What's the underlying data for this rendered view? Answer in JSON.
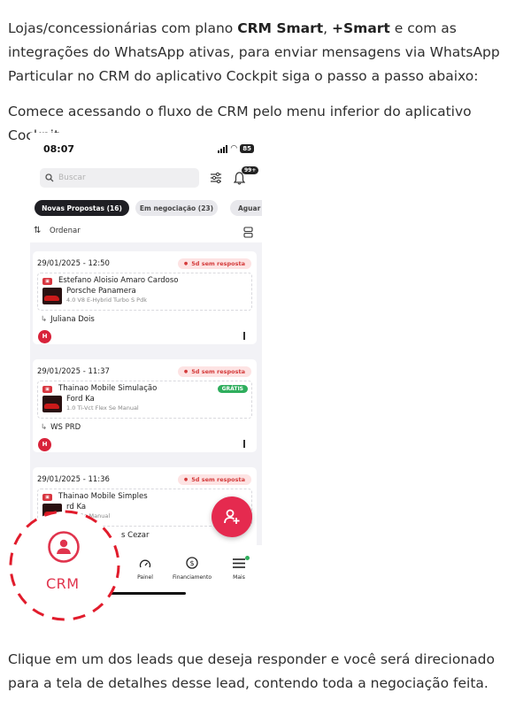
{
  "intro": {
    "p1_start": "Lojas/concessionárias com plano ",
    "p1_bold1": "CRM Smart",
    "p1_mid": ", ",
    "p1_bold2": "+Smart",
    "p1_end": " e com as integrações do WhatsApp ativas, para enviar mensagens via WhatsApp Particular no CRM do aplicativo Cockpit siga o passo a passo abaixo:",
    "p2": "Comece acessando o fluxo de CRM pelo menu inferior do aplicativo Cockpit:",
    "p3": "Clique em um dos leads que deseja responder e você será direcionado para a tela de detalhes desse lead, contendo toda a negociação feita."
  },
  "phone": {
    "time": "08:07",
    "battery": "85",
    "search_placeholder": "Buscar",
    "notification_count": "99+",
    "tabs": [
      "Novas Propostas (16)",
      "Em negociação (23)",
      "Aguar"
    ],
    "sort_label": "Ordenar",
    "cards": [
      {
        "date": "29/01/2025 - 12:50",
        "status": "5d sem resposta",
        "lead": "Estefano Aloisio Amaro Cardoso",
        "model": "Porsche Panamera",
        "version": "4.0 V8 E-Hybrid Turbo S Pdk",
        "seller": "Juliana Dois",
        "tag": ""
      },
      {
        "date": "29/01/2025 - 11:37",
        "status": "5d sem resposta",
        "lead": "Thainao Mobile Simulação",
        "model": "Ford Ka",
        "version": "1.0 Ti-Vct Flex Se Manual",
        "seller": "WS PRD",
        "tag": "GRÁTIS"
      },
      {
        "date": "29/01/2025 - 11:36",
        "status": "5d sem resposta",
        "lead": "Thainao Mobile Simples",
        "model": "rd Ka",
        "version": "Flex Se Manual",
        "seller": "s Cezar",
        "tag": ""
      }
    ],
    "bottom_nav": [
      "Painel",
      "Financiamento",
      "Mais"
    ],
    "crm_label": "CRM"
  }
}
